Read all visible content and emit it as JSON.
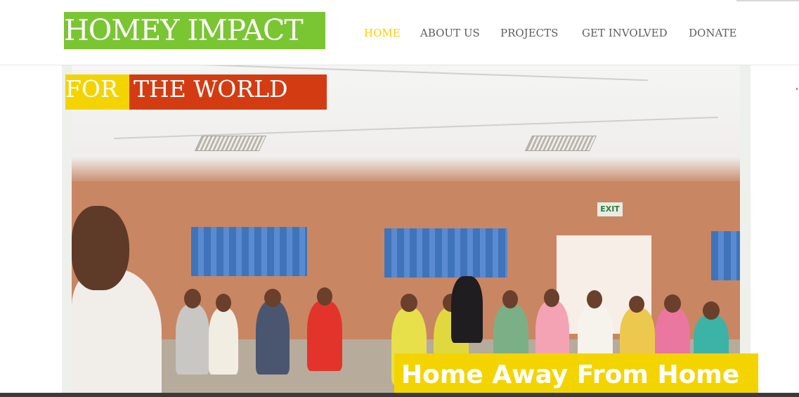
{
  "site": {
    "logo_text": "HOMEY IMPACT"
  },
  "nav": {
    "items": [
      {
        "label": "HOME",
        "active": true
      },
      {
        "label": "ABOUT US",
        "active": false
      },
      {
        "label": "PROJECTS",
        "active": false
      },
      {
        "label": "GET INVOLVED",
        "active": false
      },
      {
        "label": "DONATE",
        "active": false
      }
    ]
  },
  "hero": {
    "tagline_part1": "FOR",
    "tagline_part2": "THE WORLD",
    "caption": "Home Away From Home",
    "photo_signage": "EXIT"
  },
  "colors": {
    "brand_green": "#7ac532",
    "accent_yellow": "#f3d400",
    "nav_active": "#ffcc00",
    "accent_red": "#d33c12",
    "nav_text": "#5d5d5d"
  }
}
